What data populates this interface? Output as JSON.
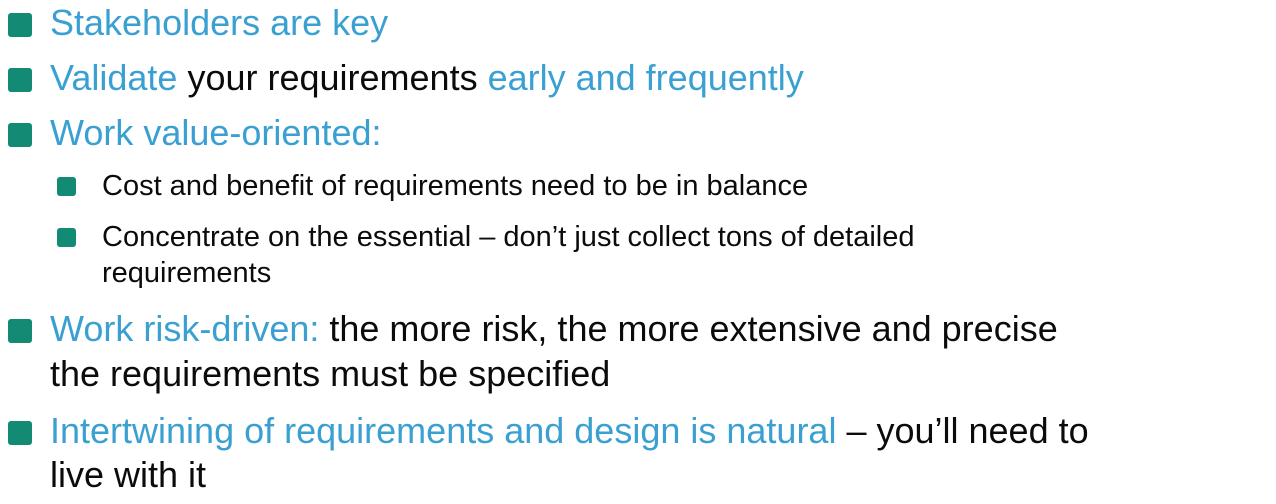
{
  "colors": {
    "accent": "#3aa0d2",
    "bullet": "#138a74",
    "text": "#0b0b0b"
  },
  "items": [
    {
      "parts": [
        {
          "text": "Stakeholders are key",
          "color": "blue"
        }
      ]
    },
    {
      "parts": [
        {
          "text": "Validate",
          "color": "blue"
        },
        {
          "text": " your requirements ",
          "color": "black"
        },
        {
          "text": "early and frequently",
          "color": "blue"
        }
      ]
    },
    {
      "parts": [
        {
          "text": "Work value-oriented:",
          "color": "blue"
        }
      ],
      "subitems": [
        {
          "text": "Cost and benefit of requirements need to be in balance"
        },
        {
          "line1": "Concentrate on the essential – don’t just collect tons of detailed",
          "line2": "requirements"
        }
      ]
    },
    {
      "parts": [
        {
          "text": "Work risk-driven:",
          "color": "blue"
        },
        {
          "text": " the more risk, the more extensive and precise",
          "color": "black"
        }
      ],
      "line2": "the requirements must be specified"
    },
    {
      "parts": [
        {
          "text": "Intertwining of requirements and design is natural",
          "color": "blue"
        },
        {
          "text": " – you’ll need to",
          "color": "black"
        }
      ],
      "line2": "live with it"
    }
  ]
}
